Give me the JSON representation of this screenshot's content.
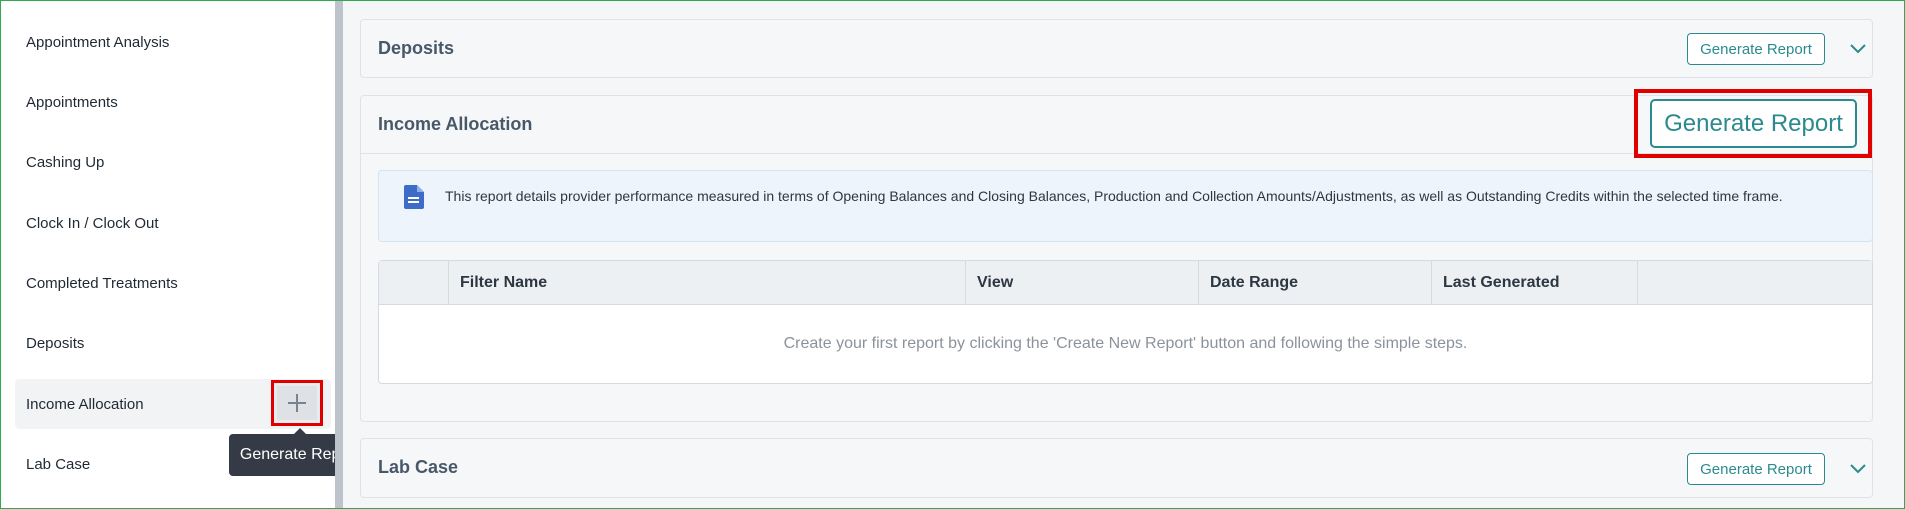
{
  "sidebar": {
    "items": [
      {
        "label": "Appointment Analysis"
      },
      {
        "label": "Appointments"
      },
      {
        "label": "Cashing Up"
      },
      {
        "label": "Clock In / Clock Out"
      },
      {
        "label": "Completed Treatments"
      },
      {
        "label": "Deposits"
      },
      {
        "label": "Income Allocation",
        "active": true
      },
      {
        "label": "Lab Case"
      }
    ],
    "tooltip": "Generate Report"
  },
  "panels": {
    "deposits": {
      "title": "Deposits",
      "button": "Generate Report"
    },
    "income_allocation": {
      "title": "Income Allocation",
      "button": "Generate Report",
      "info": "This report details provider performance measured in terms of Opening Balances and Closing Balances, Production and Collection Amounts/Adjustments, as well as Outstanding Credits within the selected time frame.",
      "table": {
        "columns": [
          "",
          "Filter Name",
          "View",
          "Date Range",
          "Last Generated",
          ""
        ],
        "empty_message": "Create your first report by clicking the 'Create New Report' button and following the simple steps."
      }
    },
    "lab_case": {
      "title": "Lab Case",
      "button": "Generate Report"
    }
  },
  "colors": {
    "accent": "#2b8a8e",
    "highlight": "#e00000",
    "frame": "#2fa84f"
  },
  "icons": {
    "add": "plus-icon",
    "expand": "chevron-down-icon",
    "info": "document-icon"
  }
}
